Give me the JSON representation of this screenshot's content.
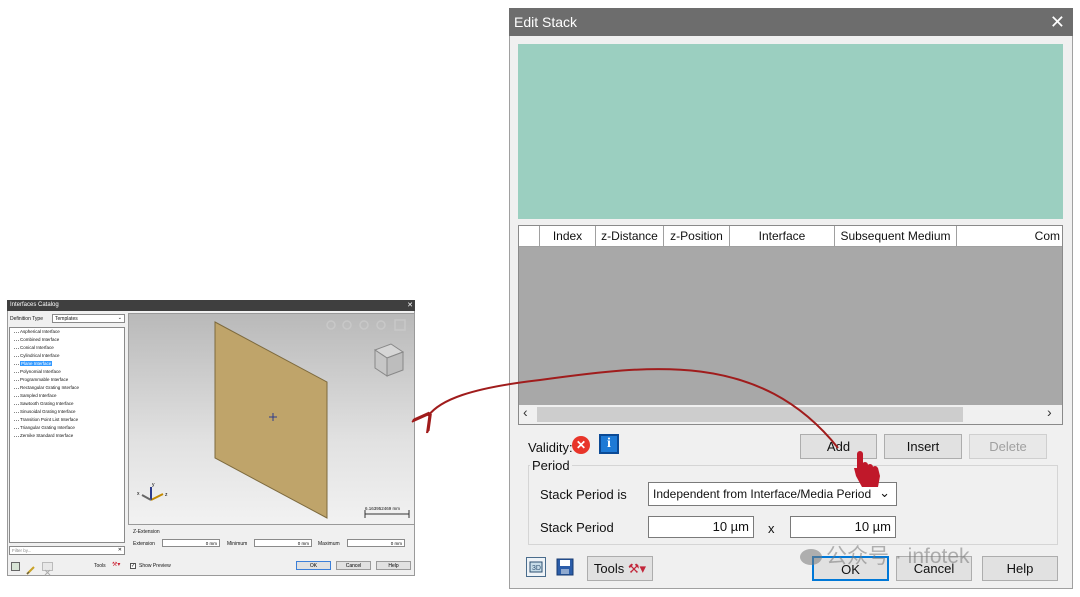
{
  "interfaces_catalog": {
    "title": "Interfaces Catalog",
    "close_glyph": "✕",
    "definition_type_label": "Definition Type",
    "definition_type_value": "Templates",
    "tree_items": [
      "Aspherical Interface",
      "Combined Interface",
      "Conical Interface",
      "Cylindrical Interface",
      "Plane Interface",
      "Polynomial Interface",
      "Programmable Interface",
      "Rectangular Grating Interface",
      "Sampled Interface",
      "Sawtooth Grating Interface",
      "Sinusoidal Grating Interface",
      "Transition Point List Interface",
      "Triangular Grating Interface",
      "Zernike Standard Interface"
    ],
    "selected_item": "Plane Interface",
    "filter_placeholder": "Filter by...",
    "filter_clear": "✕",
    "tools_label": "Tools",
    "show_preview_label": "Show Preview",
    "scale_label": "6.163952469 mm",
    "z_extension_title": "Z-Extension",
    "extension_label": "Extension",
    "extension_value": "0 mm",
    "minimum_label": "Minimum",
    "minimum_value": "0 mm",
    "maximum_label": "Maximum",
    "maximum_value": "0 mm",
    "ok_label": "OK",
    "cancel_label": "Cancel",
    "help_label": "Help",
    "colors": {
      "plane": "#bfa46a",
      "selection": "#3399ff"
    }
  },
  "edit_stack": {
    "title": "Edit Stack",
    "close_glyph": "✕",
    "columns": [
      "Index",
      "z-Distance",
      "z-Position",
      "Interface",
      "Subsequent Medium",
      "Com"
    ],
    "validity_label": "Validity:",
    "add_label": "Add",
    "insert_label": "Insert",
    "delete_label": "Delete",
    "period_group": "Period",
    "stack_period_is_label": "Stack Period is",
    "stack_period_is_value": "Independent from Interface/Media Period",
    "stack_period_label": "Stack Period",
    "period_x_value": "10 µm",
    "times": "x",
    "period_y_value": "10 µm",
    "tools_label": "Tools",
    "ok_label": "OK",
    "cancel_label": "Cancel",
    "help_label": "Help",
    "colors": {
      "preview": "#9bcfc0",
      "grid": "#a8a8a8",
      "arrow": "#a01c1c",
      "error": "#e8352a",
      "info": "#1e7ad6"
    }
  },
  "watermark": {
    "text": "公众号 · infotek"
  }
}
